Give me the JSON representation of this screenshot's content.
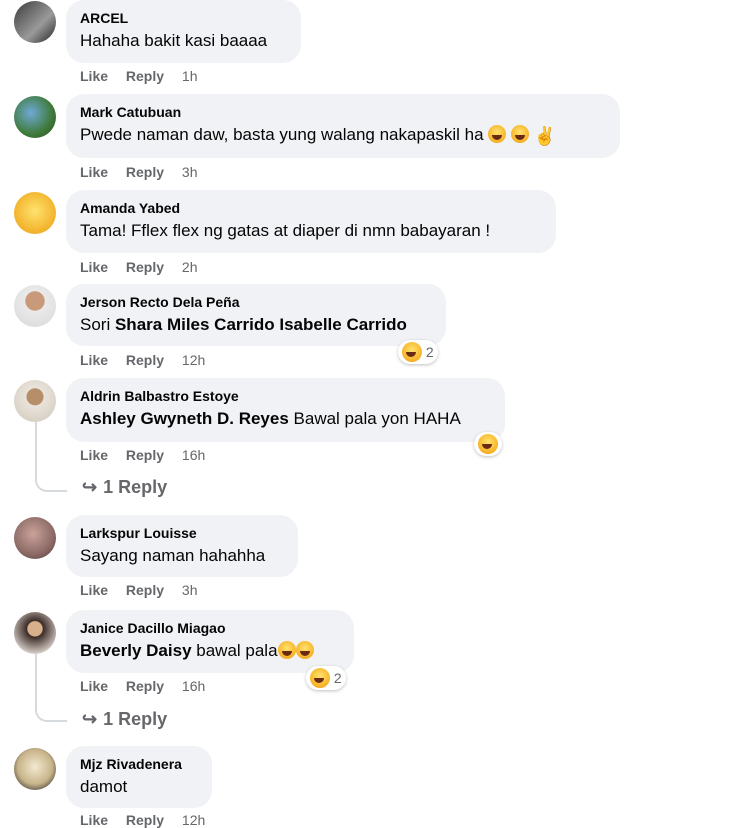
{
  "comments": [
    {
      "author": "ARCEL",
      "text": "Hahaha bakit kasi baaaa",
      "like": "Like",
      "reply": "Reply",
      "time": "1h"
    },
    {
      "author": "Mark Catubuan",
      "text": "Pwede naman daw, basta yung walang nakapaskil ha",
      "like": "Like",
      "reply": "Reply",
      "time": "3h"
    },
    {
      "author": "Amanda Yabed",
      "text": "Tama! Fflex flex ng gatas at diaper di nmn babayaran !",
      "like": "Like",
      "reply": "Reply",
      "time": "2h"
    },
    {
      "author": "Jerson Recto Dela Peña",
      "prefix": "Sori ",
      "mention": "Shara Miles Carrido Isabelle Carrido",
      "text": "",
      "like": "Like",
      "reply": "Reply",
      "time": "12h",
      "reaction_count": "2"
    },
    {
      "author": "Aldrin Balbastro Estoye",
      "mention": "Ashley Gwyneth D. Reyes",
      "text": " Bawal pala yon HAHA",
      "like": "Like",
      "reply": "Reply",
      "time": "16h",
      "replies": "1 Reply"
    },
    {
      "author": "Larkspur Louisse",
      "text": "Sayang naman hahahha",
      "like": "Like",
      "reply": "Reply",
      "time": "3h"
    },
    {
      "author": "Janice Dacillo Miagao",
      "mention": "Beverly Daisy",
      "text": " bawal pala",
      "like": "Like",
      "reply": "Reply",
      "time": "16h",
      "reaction_count": "2",
      "replies": "1 Reply"
    },
    {
      "author": "Mjz Rivadenera",
      "text": "damot",
      "like": "Like",
      "reply": "Reply",
      "time": "12h"
    }
  ]
}
